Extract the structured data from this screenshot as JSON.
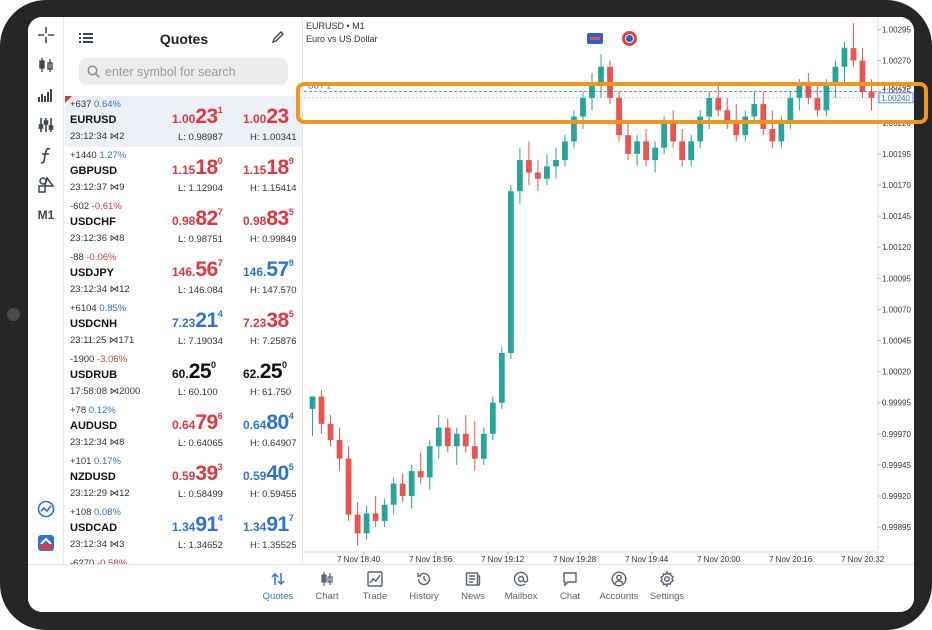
{
  "toolbar": {
    "items": [
      {
        "name": "crosshair-icon"
      },
      {
        "name": "chart-type-icon"
      },
      {
        "name": "volumes-icon"
      },
      {
        "name": "indicators-icon"
      },
      {
        "name": "function-icon"
      },
      {
        "name": "objects-icon"
      },
      {
        "name": "timeframe",
        "label": "M1"
      }
    ],
    "bottom": [
      {
        "name": "trade-signals-icon"
      },
      {
        "name": "logo-icon"
      }
    ]
  },
  "quotes": {
    "title": "Quotes",
    "search_placeholder": "enter symbol for search",
    "rows": [
      {
        "symbol": "EURUSD",
        "change_points": "+637",
        "change_pct": "0.64%",
        "dir": "up",
        "time": "23:12:34",
        "spread": "2",
        "bid": {
          "main": "1.00",
          "big": "23",
          "sup": "1",
          "color": "red"
        },
        "ask": {
          "main": "1.00",
          "big": "23",
          "sup": "",
          "color": "red"
        },
        "low": "L: 0.98987",
        "high": "H: 1.00341",
        "selected": true
      },
      {
        "symbol": "GBPUSD",
        "change_points": "+1440",
        "change_pct": "1.27%",
        "dir": "up",
        "time": "23:12:37",
        "spread": "9",
        "bid": {
          "main": "1.15",
          "big": "18",
          "sup": "0",
          "color": "red"
        },
        "ask": {
          "main": "1.15",
          "big": "18",
          "sup": "9",
          "color": "red"
        },
        "low": "L: 1.12904",
        "high": "H: 1.15414"
      },
      {
        "symbol": "USDCHF",
        "change_points": "-602",
        "change_pct": "-0.61%",
        "dir": "dn",
        "time": "23:12:36",
        "spread": "8",
        "bid": {
          "main": "0.98",
          "big": "82",
          "sup": "7",
          "color": "red"
        },
        "ask": {
          "main": "0.98",
          "big": "83",
          "sup": "5",
          "color": "red"
        },
        "low": "L: 0.98751",
        "high": "H: 0.99849"
      },
      {
        "symbol": "USDJPY",
        "change_points": "-88",
        "change_pct": "-0.06%",
        "dir": "dn",
        "time": "23:12:34",
        "spread": "12",
        "bid": {
          "main": "146.",
          "big": "56",
          "sup": "7",
          "color": "red"
        },
        "ask": {
          "main": "146.",
          "big": "57",
          "sup": "9",
          "color": "blu"
        },
        "low": "L: 146.084",
        "high": "H: 147.570"
      },
      {
        "symbol": "USDCNH",
        "change_points": "+6104",
        "change_pct": "0.85%",
        "dir": "up",
        "time": "23:11:25",
        "spread": "171",
        "bid": {
          "main": "7.23",
          "big": "21",
          "sup": "4",
          "color": "blu"
        },
        "ask": {
          "main": "7.23",
          "big": "38",
          "sup": "5",
          "color": "red"
        },
        "low": "L: 7.19034",
        "high": "H: 7.25876"
      },
      {
        "symbol": "USDRUB",
        "change_points": "-1900",
        "change_pct": "-3.06%",
        "dir": "dn",
        "time": "17:58:08",
        "spread": "2000",
        "bid": {
          "main": "60.",
          "big": "25",
          "sup": "0",
          "color": "blk"
        },
        "ask": {
          "main": "62.",
          "big": "25",
          "sup": "0",
          "color": "blk"
        },
        "low": "L: 60.100",
        "high": "H: 61.750"
      },
      {
        "symbol": "AUDUSD",
        "change_points": "+78",
        "change_pct": "0.12%",
        "dir": "up",
        "time": "23:12:34",
        "spread": "8",
        "bid": {
          "main": "0.64",
          "big": "79",
          "sup": "6",
          "color": "red"
        },
        "ask": {
          "main": "0.64",
          "big": "80",
          "sup": "4",
          "color": "blu"
        },
        "low": "L: 0.64065",
        "high": "H: 0.64907"
      },
      {
        "symbol": "NZDUSD",
        "change_points": "+101",
        "change_pct": "0.17%",
        "dir": "up",
        "time": "23:12:29",
        "spread": "12",
        "bid": {
          "main": "0.59",
          "big": "39",
          "sup": "3",
          "color": "red"
        },
        "ask": {
          "main": "0.59",
          "big": "40",
          "sup": "5",
          "color": "blu"
        },
        "low": "L: 0.58499",
        "high": "H: 0.59455"
      },
      {
        "symbol": "USDCAD",
        "change_points": "+108",
        "change_pct": "0.08%",
        "dir": "up",
        "time": "23:12:34",
        "spread": "3",
        "bid": {
          "main": "1.34",
          "big": "91",
          "sup": "4",
          "color": "blu"
        },
        "ask": {
          "main": "1.34",
          "big": "91",
          "sup": "7",
          "color": "blu"
        },
        "low": "L: 1.34652",
        "high": "H: 1.35525"
      },
      {
        "symbol": "",
        "change_points": "-6270",
        "change_pct": "-0.58%",
        "dir": "dn",
        "time": "",
        "spread": "",
        "bid": {
          "main": "",
          "big": "",
          "sup": "",
          "color": "red"
        },
        "ask": {
          "main": "",
          "big": "",
          "sup": "",
          "color": "red"
        },
        "low": "",
        "high": ""
      }
    ]
  },
  "chart": {
    "symbol": "EURUSD • M1",
    "description": "Euro vs US Dollar",
    "order_line_label": "BUY 1",
    "bid_price_label": "1.00240",
    "order_price_label": "1.00245",
    "colors": {
      "bull": "#26a69a",
      "bear": "#ef5350",
      "grid": "#f0f0f0",
      "axis_text": "#333333",
      "bid_label_border": "#2d73d6",
      "highlight": "#f0961a"
    }
  },
  "chart_data": {
    "type": "candlestick",
    "y_ticks": [
      "1.00295",
      "1.00270",
      "1.00245",
      "1.00220",
      "1.00195",
      "1.00170",
      "1.00145",
      "1.00120",
      "1.00095",
      "1.00070",
      "1.00045",
      "1.00020",
      "0.99995",
      "0.99970",
      "0.99945",
      "0.99920",
      "0.99895"
    ],
    "x_ticks": [
      "7 Nov 18:40",
      "7 Nov 18:56",
      "7 Nov 19:12",
      "7 Nov 19:28",
      "7 Nov 19:44",
      "7 Nov 20:00",
      "7 Nov 20:16",
      "7 Nov 20:32"
    ],
    "ylim": [
      0.99875,
      1.00305
    ],
    "grid": true,
    "ohlc": [
      [
        0.9999,
        1.0,
        0.99968,
        1.0
      ],
      [
        1.0,
        1.00005,
        0.9997,
        0.99978
      ],
      [
        0.99978,
        0.99985,
        0.9996,
        0.99965
      ],
      [
        0.99965,
        0.99975,
        0.9994,
        0.9995
      ],
      [
        0.9995,
        0.9996,
        0.999,
        0.99905
      ],
      [
        0.99905,
        0.99915,
        0.9988,
        0.9989
      ],
      [
        0.9989,
        0.99912,
        0.99885,
        0.99906
      ],
      [
        0.99906,
        0.9992,
        0.99895,
        0.999
      ],
      [
        0.999,
        0.99918,
        0.99895,
        0.99913
      ],
      [
        0.99913,
        0.99935,
        0.99905,
        0.9993
      ],
      [
        0.9993,
        0.99938,
        0.99915,
        0.9992
      ],
      [
        0.9992,
        0.99945,
        0.9991,
        0.9994
      ],
      [
        0.9994,
        0.99955,
        0.9993,
        0.99935
      ],
      [
        0.99935,
        0.99965,
        0.99925,
        0.9996
      ],
      [
        0.9996,
        0.99985,
        0.9995,
        0.99975
      ],
      [
        0.99975,
        0.99982,
        0.99955,
        0.9996
      ],
      [
        0.9996,
        0.99975,
        0.99945,
        0.9997
      ],
      [
        0.9997,
        0.99985,
        0.99955,
        0.9996
      ],
      [
        0.9996,
        0.9998,
        0.9994,
        0.9995
      ],
      [
        0.9995,
        0.99975,
        0.99945,
        0.9997
      ],
      [
        0.9997,
        1.0,
        0.99965,
        0.99995
      ],
      [
        0.99995,
        1.0004,
        0.9999,
        1.00035
      ],
      [
        1.00035,
        1.0017,
        1.0003,
        1.00165
      ],
      [
        1.00165,
        1.002,
        1.00155,
        1.0019
      ],
      [
        1.0019,
        1.00205,
        1.0017,
        1.0018
      ],
      [
        1.0018,
        1.0019,
        1.00165,
        1.00175
      ],
      [
        1.00175,
        1.00195,
        1.0017,
        1.00185
      ],
      [
        1.00185,
        1.002,
        1.00175,
        1.0019
      ],
      [
        1.0019,
        1.0021,
        1.00185,
        1.00205
      ],
      [
        1.00205,
        1.0023,
        1.002,
        1.00225
      ],
      [
        1.00225,
        1.00245,
        1.00215,
        1.0024
      ],
      [
        1.0024,
        1.0026,
        1.0023,
        1.0025
      ],
      [
        1.0025,
        1.00275,
        1.0024,
        1.00265
      ],
      [
        1.00265,
        1.0027,
        1.00235,
        1.0024
      ],
      [
        1.0024,
        1.00245,
        1.00205,
        1.0021
      ],
      [
        1.0021,
        1.0022,
        1.0019,
        1.00195
      ],
      [
        1.00195,
        1.0021,
        1.00185,
        1.00205
      ],
      [
        1.00205,
        1.00215,
        1.00185,
        1.0019
      ],
      [
        1.0019,
        1.00205,
        1.0018,
        1.002
      ],
      [
        1.002,
        1.00225,
        1.00195,
        1.0022
      ],
      [
        1.0022,
        1.0023,
        1.002,
        1.00205
      ],
      [
        1.00205,
        1.00215,
        1.00185,
        1.0019
      ],
      [
        1.0019,
        1.0021,
        1.00185,
        1.00205
      ],
      [
        1.00205,
        1.0023,
        1.002,
        1.00225
      ],
      [
        1.00225,
        1.00245,
        1.00215,
        1.0024
      ],
      [
        1.0024,
        1.0025,
        1.00225,
        1.0023
      ],
      [
        1.0023,
        1.0024,
        1.00215,
        1.0022
      ],
      [
        1.0022,
        1.00235,
        1.00205,
        1.0021
      ],
      [
        1.0021,
        1.0023,
        1.00205,
        1.00225
      ],
      [
        1.00225,
        1.00245,
        1.0022,
        1.00235
      ],
      [
        1.00235,
        1.00245,
        1.0021,
        1.00215
      ],
      [
        1.00215,
        1.0023,
        1.002,
        1.00205
      ],
      [
        1.00205,
        1.00225,
        1.002,
        1.0022
      ],
      [
        1.0022,
        1.00245,
        1.00215,
        1.0024
      ],
      [
        1.0024,
        1.00255,
        1.0023,
        1.0025
      ],
      [
        1.0025,
        1.0026,
        1.00235,
        1.0024
      ],
      [
        1.0024,
        1.0025,
        1.00225,
        1.0023
      ],
      [
        1.0023,
        1.00255,
        1.00225,
        1.0025
      ],
      [
        1.0025,
        1.0027,
        1.0024,
        1.00265
      ],
      [
        1.00265,
        1.00285,
        1.0025,
        1.0028
      ],
      [
        1.0028,
        1.003,
        1.00265,
        1.0027
      ],
      [
        1.0027,
        1.0028,
        1.0024,
        1.00245
      ],
      [
        1.00245,
        1.00255,
        1.0023,
        1.0024
      ]
    ]
  },
  "tabs": [
    {
      "label": "Quotes",
      "icon": "quotes-icon",
      "active": true
    },
    {
      "label": "Chart",
      "icon": "chart-icon"
    },
    {
      "label": "Trade",
      "icon": "trade-icon"
    },
    {
      "label": "History",
      "icon": "history-icon"
    },
    {
      "label": "News",
      "icon": "news-icon"
    },
    {
      "label": "Mailbox",
      "icon": "mailbox-icon"
    },
    {
      "label": "Chat",
      "icon": "chat-icon"
    },
    {
      "label": "Accounts",
      "icon": "accounts-icon"
    },
    {
      "label": "Settings",
      "icon": "settings-icon"
    }
  ]
}
